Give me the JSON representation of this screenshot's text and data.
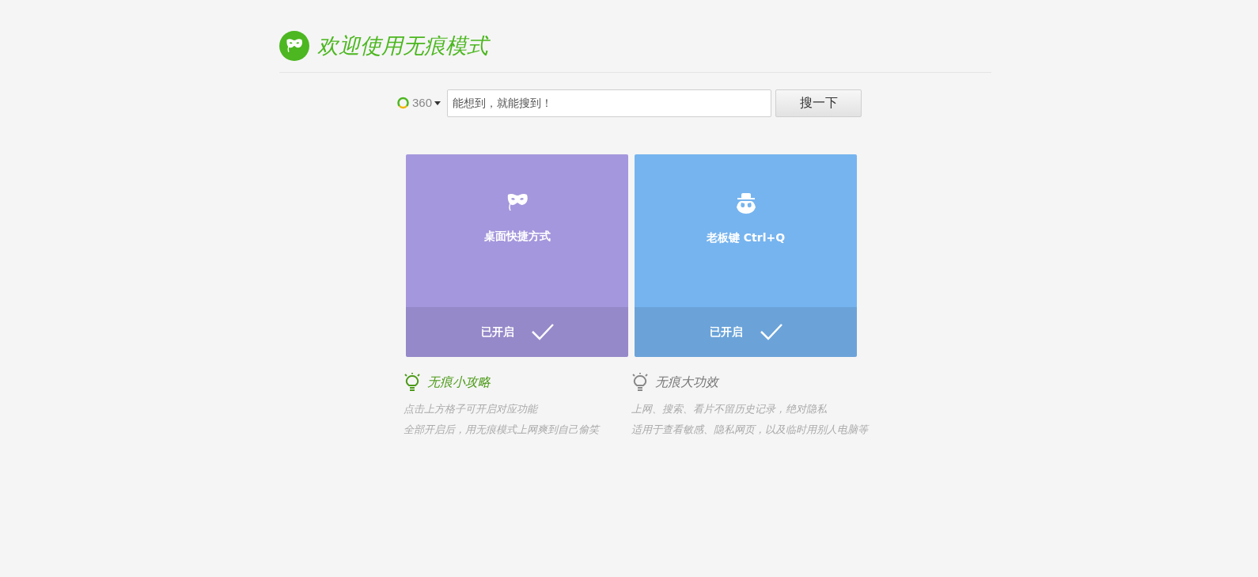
{
  "header": {
    "title": "欢迎使用无痕模式"
  },
  "search": {
    "engine": "360",
    "placeholder": "能想到，就能搜到！",
    "button": "搜一下"
  },
  "cards": [
    {
      "kind": "mask",
      "label": "桌面快捷方式",
      "status": "已开启",
      "enabled": true,
      "color": "#a597dd"
    },
    {
      "kind": "spy",
      "label": "老板键 Ctrl+Q",
      "status": "已开启",
      "enabled": true,
      "color": "#76b4ef"
    }
  ],
  "tips": [
    {
      "title": "无痕小攻略",
      "highlighted": true,
      "lines": [
        "点击上方格子可开启对应功能",
        "全部开启后，用无痕模式上网爽到自己偷笑"
      ]
    },
    {
      "title": "无痕大功效",
      "highlighted": false,
      "lines": [
        "上网、搜索、看片不留历史记录，绝对隐私",
        "适用于查看敏感、隐私网页，以及临时用别人电脑等"
      ]
    }
  ]
}
